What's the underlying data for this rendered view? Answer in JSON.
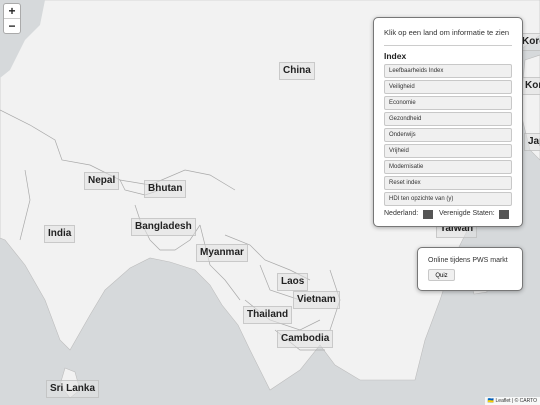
{
  "zoom": {
    "in": "+",
    "out": "−"
  },
  "countries": [
    {
      "id": "china",
      "name": "China"
    },
    {
      "id": "nepal",
      "name": "Nepal"
    },
    {
      "id": "bhutan",
      "name": "Bhutan"
    },
    {
      "id": "bangladesh",
      "name": "Bangladesh"
    },
    {
      "id": "india",
      "name": "India"
    },
    {
      "id": "myanmar",
      "name": "Myanmar"
    },
    {
      "id": "laos",
      "name": "Laos"
    },
    {
      "id": "vietnam",
      "name": "Vietnam"
    },
    {
      "id": "thailand",
      "name": "Thailand"
    },
    {
      "id": "cambodia",
      "name": "Cambodia"
    },
    {
      "id": "srilanka",
      "name": "Sri Lanka"
    },
    {
      "id": "korea",
      "name": "Korea"
    },
    {
      "id": "kor",
      "name": "Kor"
    },
    {
      "id": "jap",
      "name": "Jap"
    },
    {
      "id": "taiwan",
      "name": "Taiwan"
    }
  ],
  "info_panel": {
    "hint": "Klik op een land om informatie te zien",
    "heading": "Index",
    "buttons": [
      "Leefbaarheids Index",
      "Veiligheid",
      "Economie",
      "Gezondheid",
      "Onderwijs",
      "Vrijheid",
      "Modernisatie",
      "Reset index",
      "HDI ten opzichte van (y)"
    ],
    "legend_nl": "Nederland:",
    "legend_us": "Verenigde Staten:",
    "swatch_color": "#555555"
  },
  "online_panel": {
    "title": "Online tijdens PWS markt",
    "quiz_label": "Quiz"
  },
  "attribution": "🇺🇦 Leaflet | © CARTO",
  "colors": {
    "water": "#d6d9db",
    "land": "#f2f2f2",
    "border": "#b0b0b0"
  }
}
